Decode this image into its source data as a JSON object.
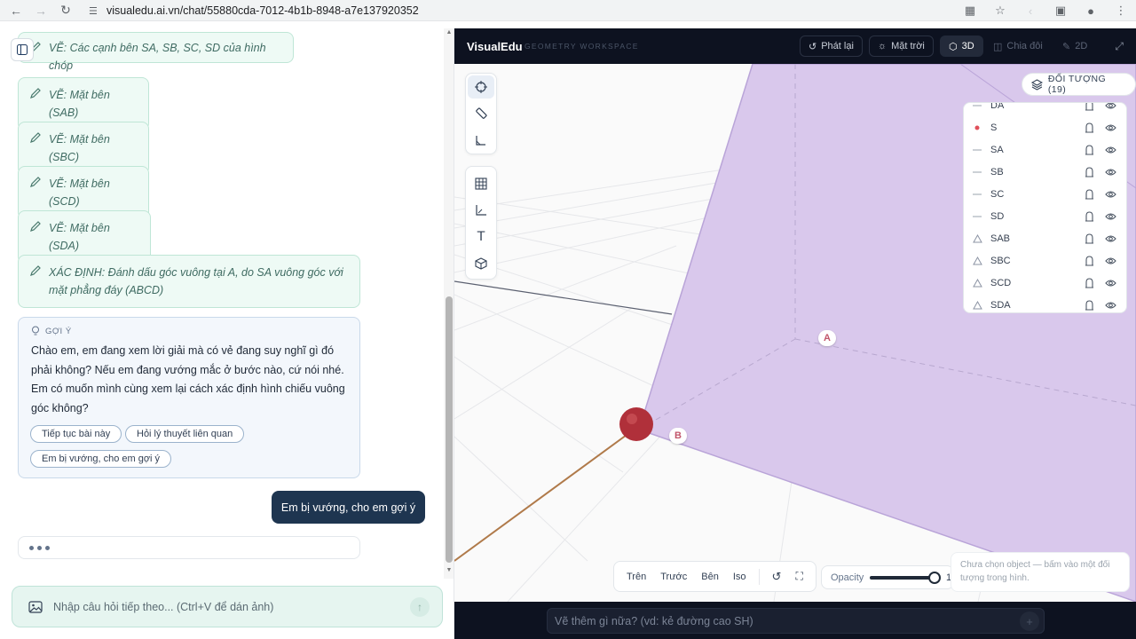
{
  "browser": {
    "url": "visualedu.ai.vn/chat/55880cda-7012-4b1b-8948-a7e137920352"
  },
  "chat": {
    "steps": [
      {
        "text": "VẼ: Các cạnh bên SA, SB, SC, SD của hình chóp"
      },
      {
        "text": "VẼ: Mặt bên (SAB)"
      },
      {
        "text": "VẼ: Mặt bên (SBC)"
      },
      {
        "text": "VẼ: Mặt bên (SCD)"
      },
      {
        "text": "VẼ: Mặt bên (SDA)"
      },
      {
        "line1": "XÁC ĐỊNH: Đánh dấu góc vuông tại A, do SA vuông góc với",
        "line2": "mặt phẳng đáy (ABCD)"
      }
    ],
    "hint": {
      "label": "GỢI Ý",
      "lines": [
        "Chào em, em đang xem lời giải mà có vẻ đang suy nghĩ gì đó",
        "phải không? Nếu em đang vướng mắc ở bước nào, cứ nói nhé.",
        "Em có muốn mình cùng xem lại cách xác định hình chiếu vuông",
        "góc không?"
      ],
      "chips": [
        "Tiếp tục bài này",
        "Hỏi lý thuyết liên quan",
        "Em bị vướng, cho em gợi ý"
      ]
    },
    "user_message": "Em bị vướng, cho em gợi ý",
    "composer_placeholder": "Nhập câu hỏi tiếp theo... (Ctrl+V để dán ảnh)"
  },
  "workspace": {
    "brand": "VisualEdu",
    "subtitle": "GEOMETRY WORKSPACE",
    "buttons": {
      "replay": "Phát lại",
      "sun": "Mặt trời",
      "view3d": "3D",
      "split": "Chia đôi",
      "view2d": "2D"
    },
    "objects_label": "ĐỐI TƯỢNG (19)",
    "objects": [
      {
        "name": "DA",
        "kind": "line"
      },
      {
        "name": "S",
        "kind": "point"
      },
      {
        "name": "SA",
        "kind": "line"
      },
      {
        "name": "SB",
        "kind": "line"
      },
      {
        "name": "SC",
        "kind": "line"
      },
      {
        "name": "SD",
        "kind": "line"
      },
      {
        "name": "SAB",
        "kind": "plane"
      },
      {
        "name": "SBC",
        "kind": "plane"
      },
      {
        "name": "SCD",
        "kind": "plane"
      },
      {
        "name": "SDA",
        "kind": "plane"
      }
    ],
    "point_labels": {
      "a": "A",
      "b": "B"
    },
    "views": [
      "Trên",
      "Trước",
      "Bên",
      "Iso"
    ],
    "opacity_label": "Opacity",
    "opacity_value": "1",
    "status": "Chưa chọn object — bấm vào một đối tượng trong hình.",
    "command_placeholder": "Vẽ thêm gì nữa? (vd: kẻ đường cao SH)",
    "colors": {
      "face": "#d9c8ec",
      "point": "#b0303a",
      "topbar": "#0d1220"
    }
  }
}
